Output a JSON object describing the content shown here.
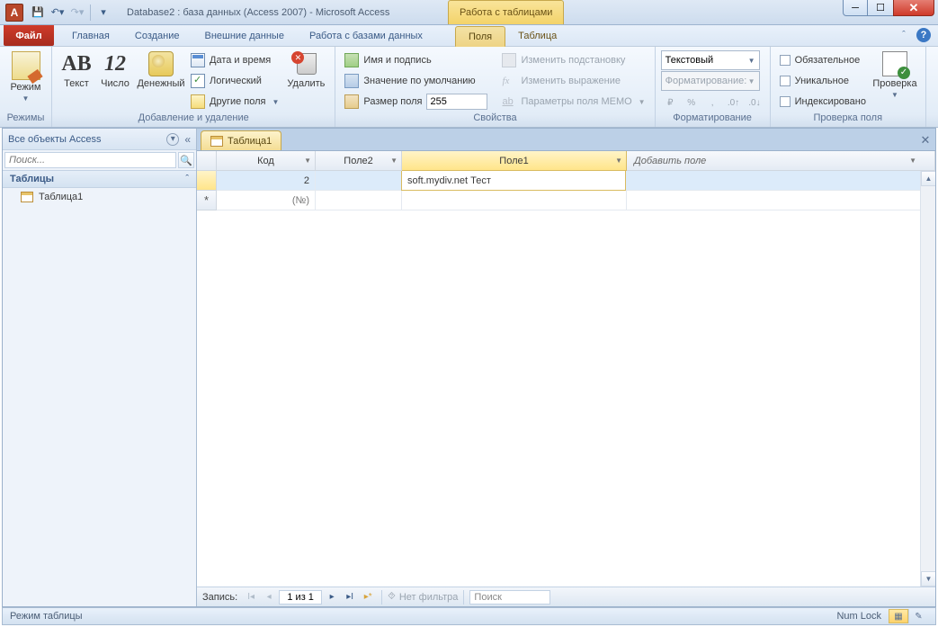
{
  "titlebar": {
    "app_letter": "A",
    "title": "Database2 : база данных (Access 2007)  -  Microsoft Access",
    "context_title": "Работа с таблицами"
  },
  "tabs": {
    "file": "Файл",
    "home": "Главная",
    "create": "Создание",
    "external": "Внешние данные",
    "dbtools": "Работа с базами данных",
    "fields": "Поля",
    "table": "Таблица"
  },
  "ribbon": {
    "modes": {
      "mode": "Режим",
      "label": "Режимы"
    },
    "add": {
      "text": "Текст",
      "text_glyph": "AB",
      "number": "Число",
      "number_glyph": "12",
      "currency": "Денежный",
      "datetime": "Дата и время",
      "boolean": "Логический",
      "more": "Другие поля",
      "delete": "Удалить",
      "label": "Добавление и удаление"
    },
    "props": {
      "name_caption": "Имя и подпись",
      "default": "Значение по умолчанию",
      "size": "Размер поля",
      "size_val": "255",
      "modify_lookup": "Изменить подстановку",
      "modify_expr": "Изменить выражение",
      "memo": "Параметры поля MEMO",
      "fx": "fx",
      "ab": "ab",
      "label": "Свойства"
    },
    "fmt": {
      "type": "Текстовый",
      "format_lbl": "Форматирование:",
      "cur": "₽",
      "pct": "%",
      "comma": ",",
      "inc": ".0↑",
      "dec": ".0↓",
      "label": "Форматирование"
    },
    "valid": {
      "required": "Обязательное",
      "unique": "Уникальное",
      "indexed": "Индексировано",
      "validate": "Проверка",
      "label": "Проверка поля"
    }
  },
  "nav": {
    "header": "Все объекты Access",
    "search_ph": "Поиск...",
    "group": "Таблицы",
    "item1": "Таблица1"
  },
  "doc": {
    "tab": "Таблица1",
    "cols": {
      "id": "Код",
      "f2": "Поле2",
      "f1": "Поле1",
      "add": "Добавить поле"
    },
    "row1": {
      "id": "2",
      "f2": "",
      "f1": "soft.mydiv.net Тест"
    },
    "row_new": "(№)",
    "recnav": {
      "label": "Запись:",
      "pos": "1 из 1",
      "nofilter": "Нет фильтра",
      "search": "Поиск"
    }
  },
  "status": {
    "mode": "Режим таблицы",
    "numlock": "Num Lock"
  }
}
